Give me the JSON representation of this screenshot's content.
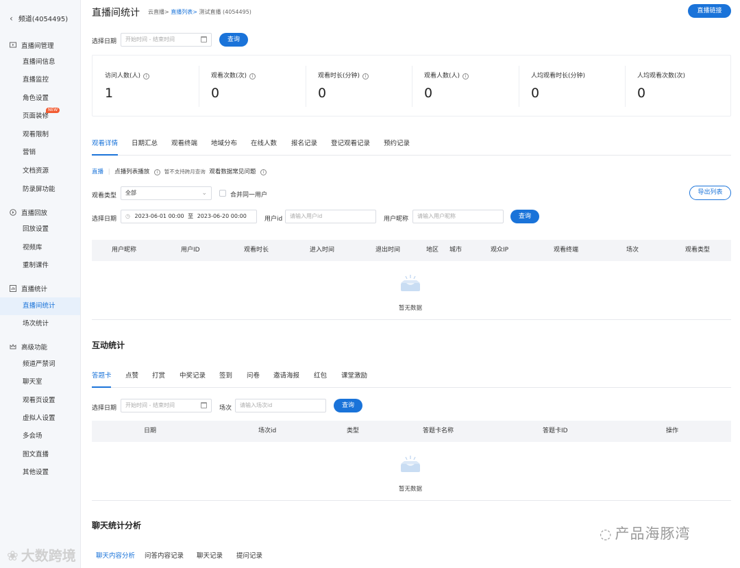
{
  "sidebar": {
    "back_label": "频道(4054495)",
    "groups": [
      {
        "label": "直播间管理",
        "items": [
          "直播间信息",
          "直播监控",
          "角色设置",
          "页面装修",
          "观看限制",
          "营销",
          "文档资源",
          "防录屏功能"
        ]
      },
      {
        "label": "直播回放",
        "items": [
          "回放设置",
          "视频库",
          "重制课件"
        ]
      },
      {
        "label": "直播统计",
        "items": [
          "直播间统计",
          "场次统计"
        ]
      },
      {
        "label": "高级功能",
        "items": [
          "频道严禁词",
          "聊天室",
          "观看页设置",
          "虚拟人设置",
          "多会场",
          "图文直播",
          "其他设置"
        ]
      }
    ],
    "new_badge": "NEW",
    "active_item": "直播间统计"
  },
  "header": {
    "title": "直播间统计",
    "breadcrumb": {
      "part1": "云直播>",
      "part2": "直播列表>",
      "part3": "测试直播 (4054495)"
    },
    "live_link_button": "直播链接"
  },
  "top_filter": {
    "date_label": "选择日期",
    "date_placeholder": "开始时间 - 结束时间",
    "query_button": "查询"
  },
  "stats": [
    {
      "label": "访问人数(人)",
      "value": "1",
      "info": true
    },
    {
      "label": "观看次数(次)",
      "value": "0",
      "info": true
    },
    {
      "label": "观看时长(分钟)",
      "value": "0",
      "info": true
    },
    {
      "label": "观看人数(人)",
      "value": "0",
      "info": true
    },
    {
      "label": "人均观看时长(分钟)",
      "value": "0",
      "info": false
    },
    {
      "label": "人均观看次数(次)",
      "value": "0",
      "info": false
    }
  ],
  "view_tabs": [
    "观看详情",
    "日期汇总",
    "观看终端",
    "地域分布",
    "在线人数",
    "报名记录",
    "登记观看记录",
    "预约记录"
  ],
  "view_sub": {
    "live": "直播",
    "vod": "点播列表播放",
    "note": "暂不支持跨月查询",
    "faq": "观看数据常见问题"
  },
  "view_filter": {
    "type_label": "观看类型",
    "type_value": "全部",
    "merge_label": "合并同一用户",
    "export_button": "导出列表",
    "date_label": "选择日期",
    "date_start": "2023-06-01 00:00",
    "date_sep": "至",
    "date_end": "2023-06-20 00:00",
    "userid_label": "用户id",
    "userid_placeholder": "请输入用户id",
    "nick_label": "用户昵称",
    "nick_placeholder": "请输入用户昵称",
    "query_button": "查询"
  },
  "view_table": {
    "columns": [
      "用户昵称",
      "用户ID",
      "观看时长",
      "进入时间",
      "退出时间",
      "地区",
      "城市",
      "观众IP",
      "观看终端",
      "场次",
      "观看类型"
    ],
    "empty_text": "暂无数据"
  },
  "interact": {
    "title": "互动统计",
    "tabs": [
      "答题卡",
      "点赞",
      "打赏",
      "中奖记录",
      "签到",
      "问卷",
      "邀请海报",
      "红包",
      "课堂激励"
    ],
    "date_label": "选择日期",
    "date_placeholder": "开始时间 - 结束时间",
    "session_label": "场次",
    "session_placeholder": "请输入场次id",
    "query_button": "查询",
    "columns": [
      "日期",
      "场次id",
      "类型",
      "答题卡名称",
      "答题卡ID",
      "操作"
    ],
    "empty_text": "暂无数据"
  },
  "chat": {
    "title": "聊天统计分析",
    "tabs": [
      "聊天内容分析",
      "问答内容记录",
      "聊天记录",
      "提问记录"
    ]
  },
  "watermarks": {
    "right": "产品海豚湾",
    "left": "大数跨境"
  },
  "colors": {
    "accent": "#1a73d9",
    "badge": "#f25c33"
  }
}
